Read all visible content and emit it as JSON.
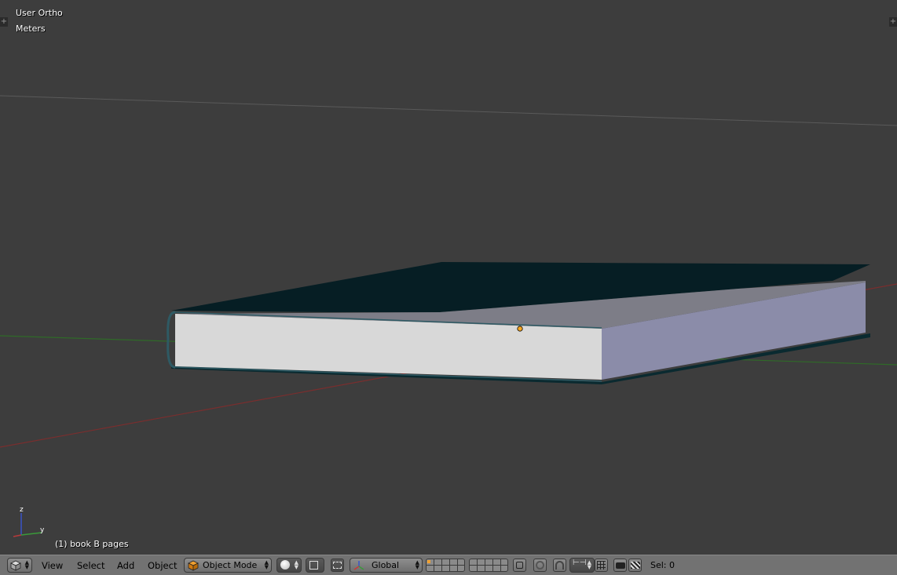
{
  "viewport": {
    "view_name": "User Ortho",
    "units": "Meters",
    "active_object": "(1) book B pages",
    "axis_labels": {
      "z": "z",
      "y": "y"
    }
  },
  "header": {
    "editor_type_icon": "cube-icon",
    "menus": [
      "View",
      "Select",
      "Add",
      "Object"
    ],
    "mode": "Object Mode",
    "transform_orientation": "Global",
    "selection_info": "Sel: 0"
  },
  "colors": {
    "viewport_bg": "#3d3d3d",
    "x_axis": "#8a2a2a",
    "y_axis": "#3a7a2a",
    "book_cover": "#061e24",
    "pages_front": "#d9d9d9",
    "pages_side": "#8c8caa",
    "pages_top": "#7e7e88",
    "origin_dot": "#f5a623"
  }
}
